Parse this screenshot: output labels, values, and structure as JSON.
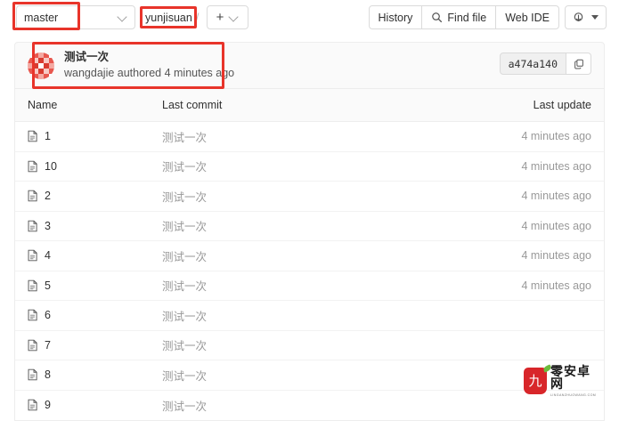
{
  "toolbar": {
    "branch": {
      "name": "master",
      "icon": "chevron-down-icon"
    },
    "breadcrumb": {
      "repo": "yunjisuan",
      "separator": "/"
    },
    "add_button": {
      "label": "+",
      "icon": "chevron-down-icon"
    },
    "actions": [
      {
        "label": "History",
        "icon": null
      },
      {
        "label": "Find file",
        "icon": "search-icon"
      },
      {
        "label": "Web IDE",
        "icon": null
      }
    ],
    "clone_button": {
      "icon": "download-icon",
      "caret": "caret-down-icon"
    }
  },
  "commit": {
    "title": "测试一次",
    "author": "wangdajie",
    "meta": "wangdajie authored 4 minutes ago",
    "authored_text": "authored",
    "time_ago": "4 minutes ago",
    "sha": "a474a140",
    "copy_icon": "copy-icon",
    "avatar": "identicon-avatar"
  },
  "file_table": {
    "headers": {
      "name": "Name",
      "last_commit": "Last commit",
      "last_update": "Last update"
    },
    "rows": [
      {
        "icon": "file-icon",
        "name": "1",
        "last_commit": "测试一次",
        "last_update": "4 minutes ago"
      },
      {
        "icon": "file-icon",
        "name": "10",
        "last_commit": "测试一次",
        "last_update": "4 minutes ago"
      },
      {
        "icon": "file-icon",
        "name": "2",
        "last_commit": "测试一次",
        "last_update": "4 minutes ago"
      },
      {
        "icon": "file-icon",
        "name": "3",
        "last_commit": "测试一次",
        "last_update": "4 minutes ago"
      },
      {
        "icon": "file-icon",
        "name": "4",
        "last_commit": "测试一次",
        "last_update": "4 minutes ago"
      },
      {
        "icon": "file-icon",
        "name": "5",
        "last_commit": "测试一次",
        "last_update": "4 minutes ago"
      },
      {
        "icon": "file-icon",
        "name": "6",
        "last_commit": "测试一次",
        "last_update": ""
      },
      {
        "icon": "file-icon",
        "name": "7",
        "last_commit": "测试一次",
        "last_update": ""
      },
      {
        "icon": "file-icon",
        "name": "8",
        "last_commit": "测试一次",
        "last_update": ""
      },
      {
        "icon": "file-icon",
        "name": "9",
        "last_commit": "测试一次",
        "last_update": ""
      }
    ]
  },
  "annotations": {
    "color": "#e8342a",
    "boxes": [
      "branch-selector",
      "breadcrumb-repo",
      "commit-summary"
    ]
  },
  "watermark": {
    "seal_char": "九",
    "main_text": "零安卓网",
    "sub_text": "LINGANZHUOWANG.COM"
  }
}
